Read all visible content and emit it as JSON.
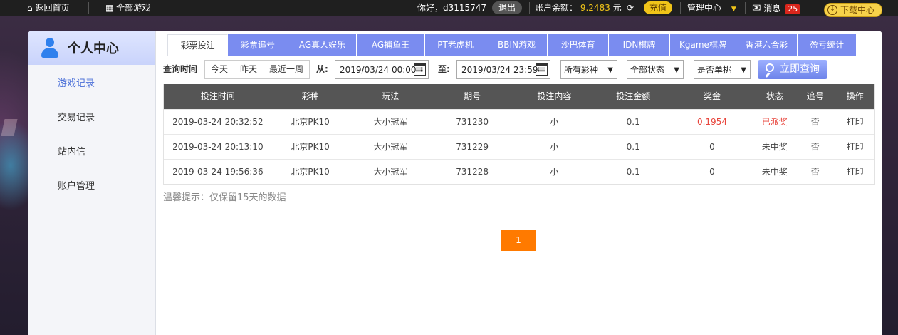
{
  "topbar": {
    "home": "返回首页",
    "all_games": "全部游戏",
    "greeting": "你好，d3115747",
    "logout": "退出",
    "balance_label": "账户余额：",
    "balance_value": "9.2483",
    "currency": "元",
    "recharge": "充值",
    "manage": "管理中心",
    "messages": "消息",
    "message_count": "25",
    "download": "下载中心"
  },
  "sidebar": {
    "title": "个人中心",
    "items": [
      {
        "label": "游戏记录",
        "active": true
      },
      {
        "label": "交易记录",
        "active": false
      },
      {
        "label": "站内信",
        "active": false
      },
      {
        "label": "账户管理",
        "active": false
      }
    ]
  },
  "tabs": [
    {
      "label": "彩票投注",
      "active": true
    },
    {
      "label": "彩票追号"
    },
    {
      "label": "AG真人娱乐"
    },
    {
      "label": "AG捕鱼王"
    },
    {
      "label": "PT老虎机"
    },
    {
      "label": "BBIN游戏"
    },
    {
      "label": "沙巴体育"
    },
    {
      "label": "IDN棋牌"
    },
    {
      "label": "Kgame棋牌"
    },
    {
      "label": "香港六合彩"
    },
    {
      "label": "盈亏统计"
    }
  ],
  "filters": {
    "query_time_label": "查询时间",
    "quick": [
      "今天",
      "昨天",
      "最近一周"
    ],
    "from_label": "从:",
    "from_value": "2019/03/24 00:00",
    "to_label": "至:",
    "to_value": "2019/03/24 23:59",
    "lottery_select": "所有彩种",
    "status_select": "全部状态",
    "single_select": "是否单挑",
    "query_button": "立即查询"
  },
  "table": {
    "headers": [
      "投注时间",
      "彩种",
      "玩法",
      "期号",
      "投注内容",
      "投注金额",
      "奖金",
      "状态",
      "追号",
      "操作"
    ],
    "rows": [
      [
        "2019-03-24 20:32:52",
        "北京PK10",
        "大小冠军",
        "731230",
        "小",
        "0.1",
        "0.1954",
        "已派奖",
        "否",
        "打印"
      ],
      [
        "2019-03-24 20:13:10",
        "北京PK10",
        "大小冠军",
        "731229",
        "小",
        "0.1",
        "0",
        "未中奖",
        "否",
        "打印"
      ],
      [
        "2019-03-24 19:56:36",
        "北京PK10",
        "大小冠军",
        "731228",
        "小",
        "0.1",
        "0",
        "未中奖",
        "否",
        "打印"
      ]
    ]
  },
  "hint": "温馨提示：仅保留15天的数据",
  "pagination": {
    "current": "1"
  },
  "colors": {
    "accent": "#7a8cf0",
    "page": "#ff7a00",
    "win": "#e8453c"
  }
}
